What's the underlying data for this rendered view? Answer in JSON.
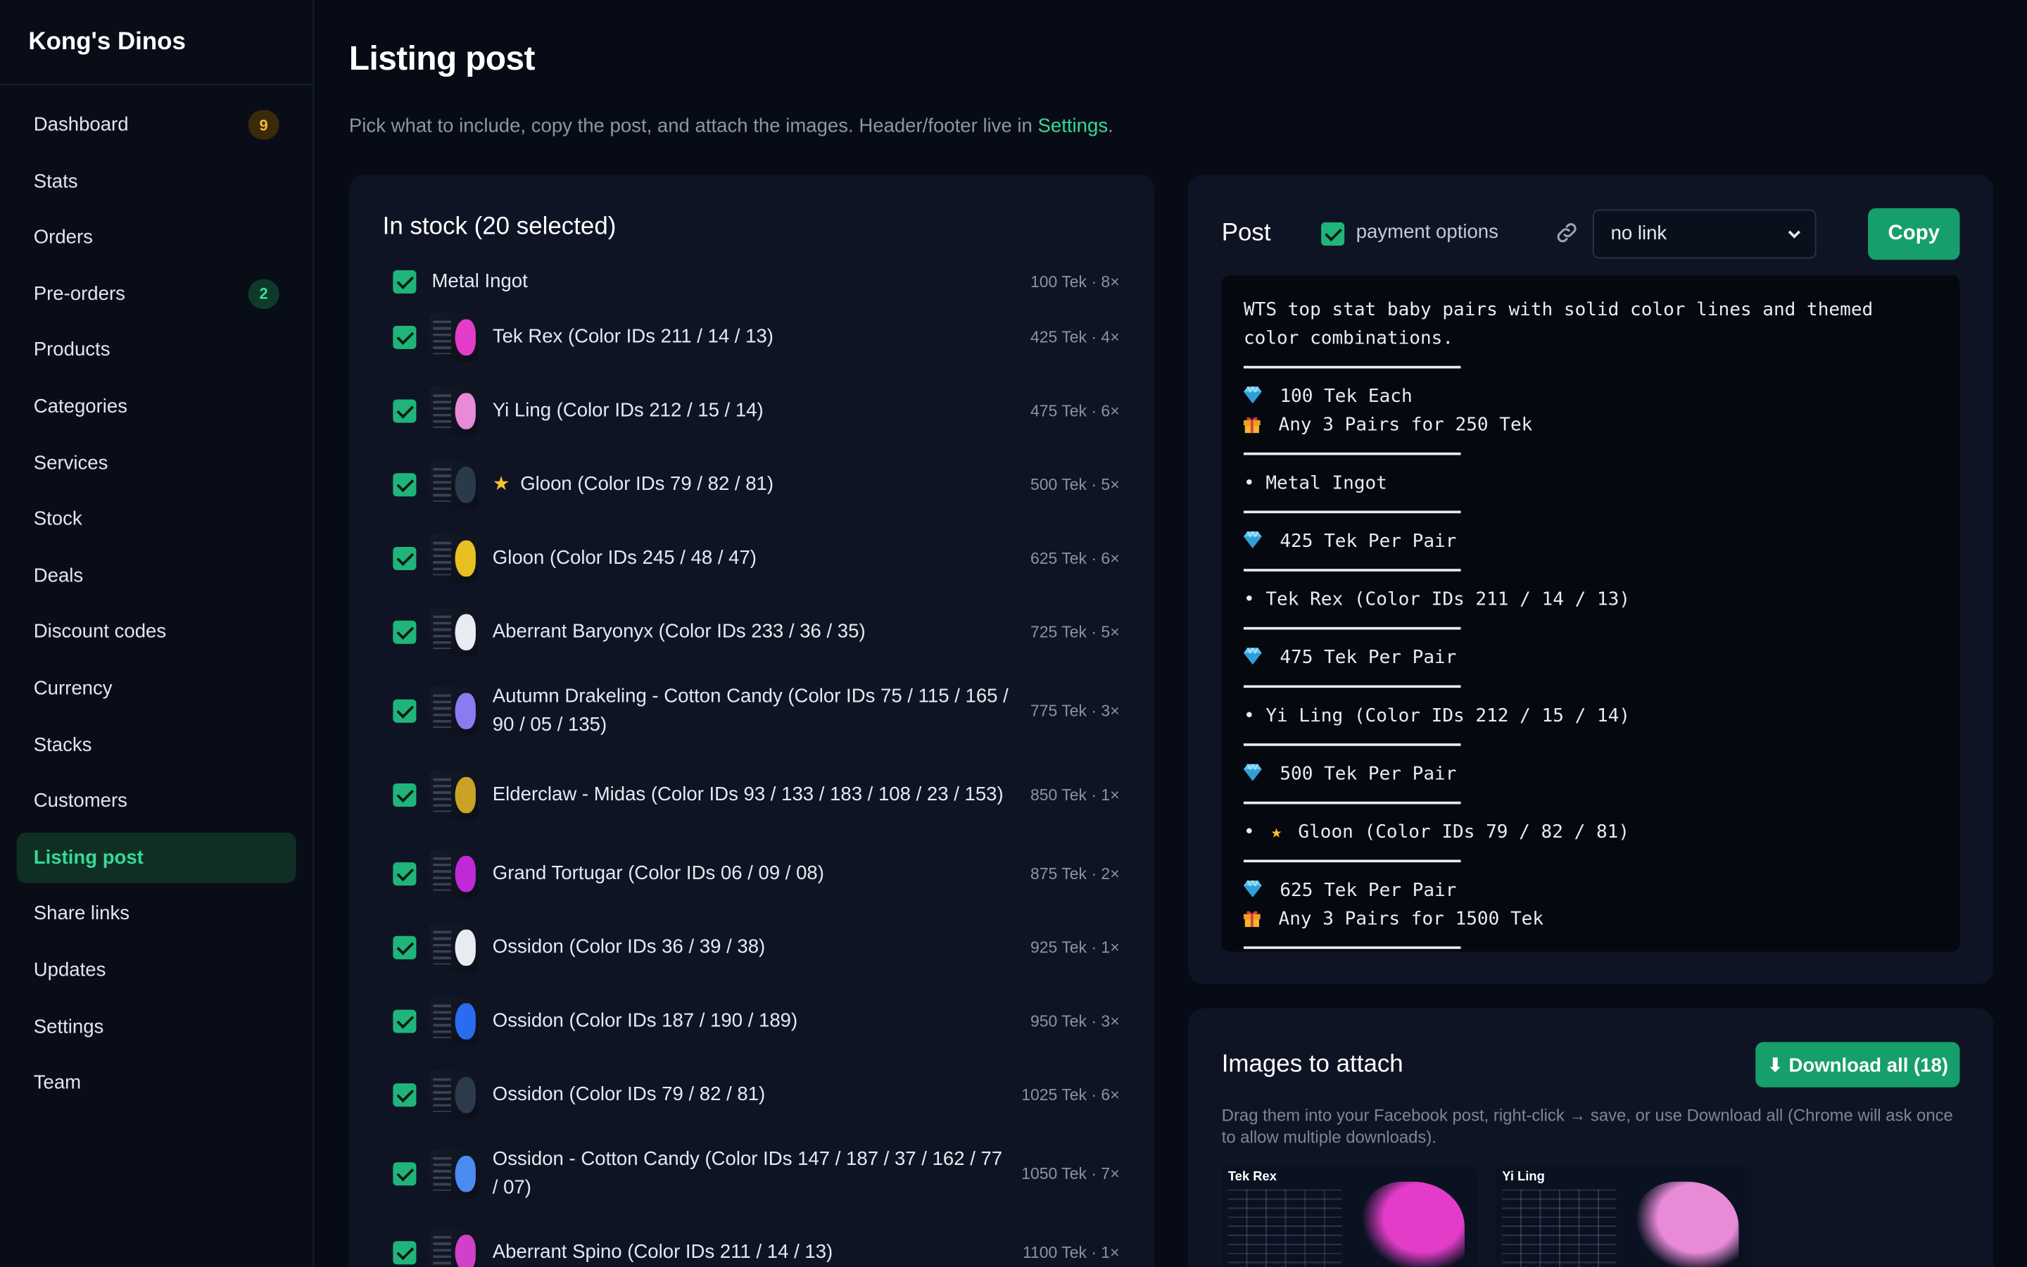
{
  "brand": "Kong's Dinos",
  "nav": [
    {
      "id": "dashboard",
      "label": "Dashboard",
      "badge": "9",
      "badge_tone": "amber",
      "active": false
    },
    {
      "id": "stats",
      "label": "Stats",
      "badge": "",
      "active": false
    },
    {
      "id": "orders",
      "label": "Orders",
      "badge": "",
      "active": false
    },
    {
      "id": "pre-orders",
      "label": "Pre-orders",
      "badge": "2",
      "badge_tone": "green",
      "active": false
    },
    {
      "id": "products",
      "label": "Products",
      "badge": "",
      "active": false
    },
    {
      "id": "categories",
      "label": "Categories",
      "badge": "",
      "active": false
    },
    {
      "id": "services",
      "label": "Services",
      "badge": "",
      "active": false
    },
    {
      "id": "stock",
      "label": "Stock",
      "badge": "",
      "active": false
    },
    {
      "id": "deals",
      "label": "Deals",
      "badge": "",
      "active": false
    },
    {
      "id": "discount-codes",
      "label": "Discount codes",
      "badge": "",
      "active": false
    },
    {
      "id": "currency",
      "label": "Currency",
      "badge": "",
      "active": false
    },
    {
      "id": "stacks",
      "label": "Stacks",
      "badge": "",
      "active": false
    },
    {
      "id": "customers",
      "label": "Customers",
      "badge": "",
      "active": false
    },
    {
      "id": "listing-post",
      "label": "Listing post",
      "badge": "",
      "active": true
    },
    {
      "id": "share-links",
      "label": "Share links",
      "badge": "",
      "active": false
    },
    {
      "id": "updates",
      "label": "Updates",
      "badge": "",
      "active": false
    },
    {
      "id": "settings",
      "label": "Settings",
      "badge": "",
      "active": false
    },
    {
      "id": "team",
      "label": "Team",
      "badge": "",
      "active": false
    }
  ],
  "page": {
    "title": "Listing post",
    "subtitle_before": "Pick what to include, copy the post, and attach the images. Header/footer live in ",
    "subtitle_link": "Settings",
    "subtitle_after": "."
  },
  "stock": {
    "title": "In stock (20 selected)",
    "items": [
      {
        "name": "Metal Ingot",
        "meta": "100 Tek · 8×",
        "image": false,
        "star": false,
        "checked": true,
        "color": ""
      },
      {
        "name": "Tek Rex (Color IDs 211 / 14 / 13)",
        "meta": "425 Tek · 4×",
        "image": true,
        "star": false,
        "checked": true,
        "color": "#e23cc8"
      },
      {
        "name": "Yi Ling (Color IDs 212 / 15 / 14)",
        "meta": "475 Tek · 6×",
        "image": true,
        "star": false,
        "checked": true,
        "color": "#e88ad8"
      },
      {
        "name": "Gloon (Color IDs 79 / 82 / 81)",
        "meta": "500 Tek · 5×",
        "image": true,
        "star": true,
        "checked": true,
        "color": "#2a3a4a"
      },
      {
        "name": "Gloon (Color IDs 245 / 48 / 47)",
        "meta": "625 Tek · 6×",
        "image": true,
        "star": false,
        "checked": true,
        "color": "#e8c020"
      },
      {
        "name": "Aberrant Baryonyx (Color IDs 233 / 36 / 35)",
        "meta": "725 Tek · 5×",
        "image": true,
        "star": false,
        "checked": true,
        "color": "#e8ecf2"
      },
      {
        "name": "Autumn Drakeling - Cotton Candy (Color IDs 75 / 115 / 165 / 90 / 05 / 135)",
        "meta": "775 Tek · 3×",
        "image": true,
        "star": false,
        "checked": true,
        "color": "#8a7cf0"
      },
      {
        "name": "Elderclaw - Midas (Color IDs 93 / 133 / 183 / 108 / 23 / 153)",
        "meta": "850 Tek · 1×",
        "image": true,
        "star": false,
        "checked": true,
        "color": "#c9a226"
      },
      {
        "name": "Grand Tortugar (Color IDs 06 / 09 / 08)",
        "meta": "875 Tek · 2×",
        "image": true,
        "star": false,
        "checked": true,
        "color": "#c02ad6"
      },
      {
        "name": "Ossidon (Color IDs 36 / 39 / 38)",
        "meta": "925 Tek · 1×",
        "image": true,
        "star": false,
        "checked": true,
        "color": "#e8ecf2"
      },
      {
        "name": "Ossidon (Color IDs 187 / 190 / 189)",
        "meta": "950 Tek · 3×",
        "image": true,
        "star": false,
        "checked": true,
        "color": "#2a6cf0"
      },
      {
        "name": "Ossidon (Color IDs 79 / 82 / 81)",
        "meta": "1025 Tek · 6×",
        "image": true,
        "star": false,
        "checked": true,
        "color": "#2c3a4c"
      },
      {
        "name": "Ossidon - Cotton Candy (Color IDs 147 / 187 / 37 / 162 / 77 / 07)",
        "meta": "1050 Tek · 7×",
        "image": true,
        "star": false,
        "checked": true,
        "color": "#4a8cf0"
      },
      {
        "name": "Aberrant Spino (Color IDs 211 / 14 / 13)",
        "meta": "1100 Tek · 1×",
        "image": true,
        "star": false,
        "checked": true,
        "color": "#d040c8"
      }
    ]
  },
  "post": {
    "title": "Post",
    "payment_label": "payment options",
    "payment_checked": true,
    "link_select": "no link",
    "copy_label": "Copy",
    "body": [
      {
        "kind": "wrap",
        "text": "WTS top stat baby pairs with solid color lines and themed color combinations."
      },
      {
        "kind": "rule"
      },
      {
        "kind": "gem",
        "text": "100 Tek Each"
      },
      {
        "kind": "gift",
        "text": "Any 3 Pairs for 250 Tek"
      },
      {
        "kind": "rule"
      },
      {
        "kind": "text",
        "text": "• Metal Ingot"
      },
      {
        "kind": "rule"
      },
      {
        "kind": "gem",
        "text": "425 Tek Per Pair"
      },
      {
        "kind": "rule"
      },
      {
        "kind": "text",
        "text": "• Tek Rex (Color IDs 211 / 14 / 13)"
      },
      {
        "kind": "rule"
      },
      {
        "kind": "gem",
        "text": "475 Tek Per Pair"
      },
      {
        "kind": "rule"
      },
      {
        "kind": "text",
        "text": "• Yi Ling (Color IDs 212 / 15 / 14)"
      },
      {
        "kind": "rule"
      },
      {
        "kind": "gem",
        "text": "500 Tek Per Pair"
      },
      {
        "kind": "rule"
      },
      {
        "kind": "star",
        "prefix": "•",
        "text": "Gloon (Color IDs 79 / 82 / 81)"
      },
      {
        "kind": "rule"
      },
      {
        "kind": "gem",
        "text": "625 Tek Per Pair"
      },
      {
        "kind": "gift",
        "text": "Any 3 Pairs for 1500 Tek"
      },
      {
        "kind": "rule"
      }
    ]
  },
  "images": {
    "title": "Images to attach",
    "download_label": "⬇ Download all (18)",
    "hint": "Drag them into your Facebook post, right-click → save, or use Download all (Chrome will ask once to allow multiple downloads).",
    "thumbs": [
      {
        "title": "Tek Rex",
        "color": "#e23cc8"
      },
      {
        "title": "Yi Ling",
        "color": "#e88ad8"
      }
    ]
  },
  "colors": {
    "accent": "#37d996",
    "button": "#169e6b",
    "star": "#f5c32c"
  }
}
